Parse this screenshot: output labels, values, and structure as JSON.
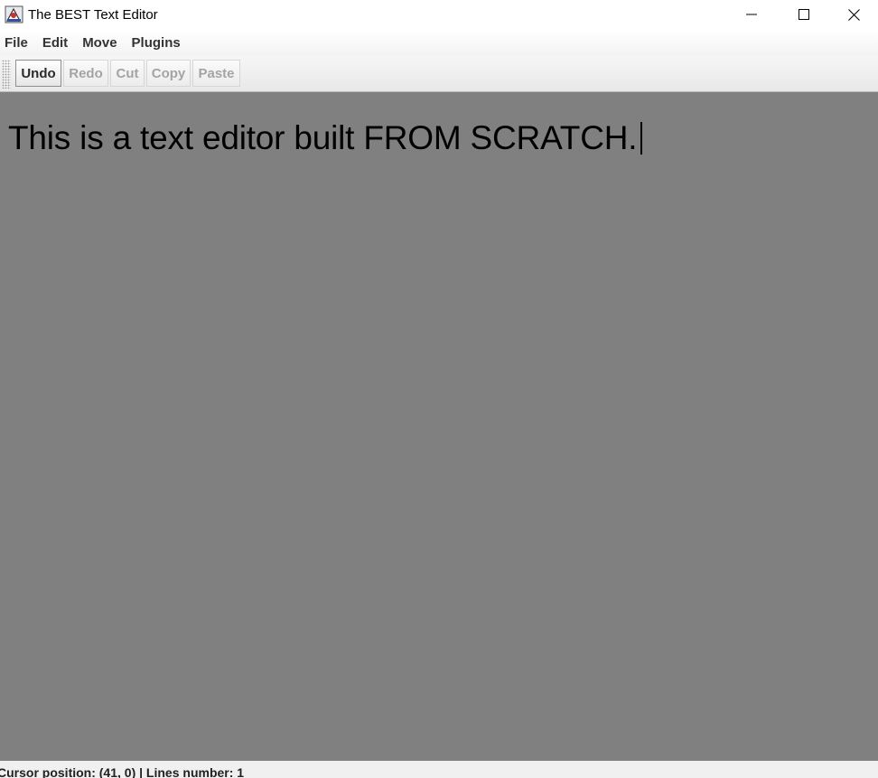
{
  "window": {
    "title": "The BEST Text Editor",
    "icon": "java-app-icon",
    "controls": [
      "minimize-icon",
      "maximize-icon",
      "close-icon"
    ]
  },
  "menubar": {
    "items": [
      {
        "label": "File"
      },
      {
        "label": "Edit"
      },
      {
        "label": "Move"
      },
      {
        "label": "Plugins"
      }
    ]
  },
  "toolbar": {
    "buttons": [
      {
        "label": "Undo",
        "enabled": true
      },
      {
        "label": "Redo",
        "enabled": false
      },
      {
        "label": "Cut",
        "enabled": false
      },
      {
        "label": "Copy",
        "enabled": false
      },
      {
        "label": "Paste",
        "enabled": false
      }
    ]
  },
  "editor": {
    "text": "This is a text editor built FROM SCRATCH.",
    "background": "#808080",
    "text_color": "#000000"
  },
  "statusbar": {
    "text": "Cursor position: (41, 0) | Lines number: 1"
  }
}
